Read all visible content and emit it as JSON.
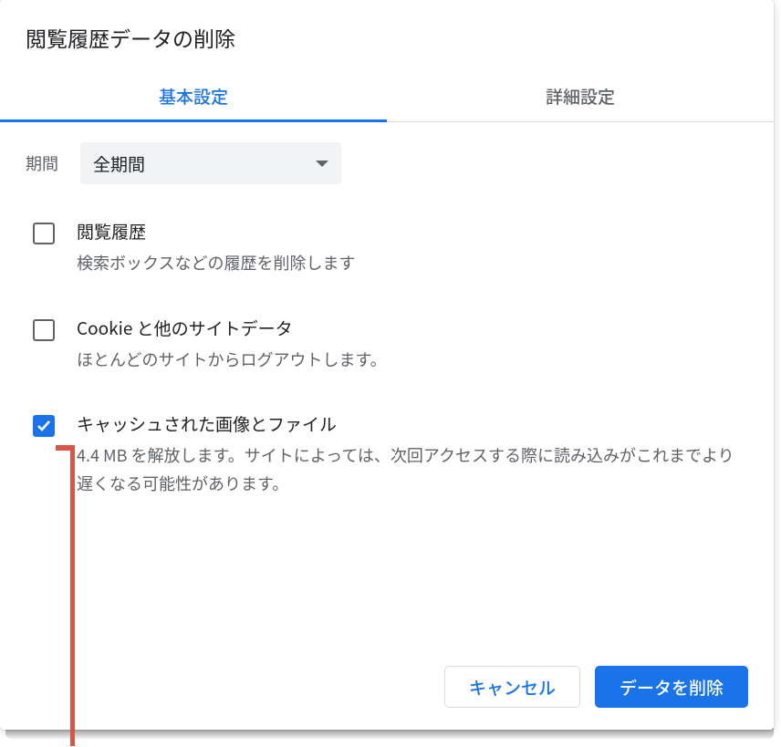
{
  "dialog": {
    "title": "閲覧履歴データの削除"
  },
  "tabs": {
    "basic": "基本設定",
    "advanced": "詳細設定"
  },
  "period": {
    "label": "期間",
    "value": "全期間"
  },
  "options": [
    {
      "title": "閲覧履歴",
      "desc": "検索ボックスなどの履歴を削除します",
      "checked": false
    },
    {
      "title": "Cookie と他のサイトデータ",
      "desc": "ほとんどのサイトからログアウトします。",
      "checked": false
    },
    {
      "title": "キャッシュされた画像とファイル",
      "desc": "4.4 MB を解放します。サイトによっては、次回アクセスする際に読み込みがこれまでより遅くなる可能性があります。",
      "checked": true
    }
  ],
  "buttons": {
    "cancel": "キャンセル",
    "delete": "データを削除"
  },
  "colors": {
    "accent": "#1a73e8",
    "annotation": "#d9554a"
  }
}
